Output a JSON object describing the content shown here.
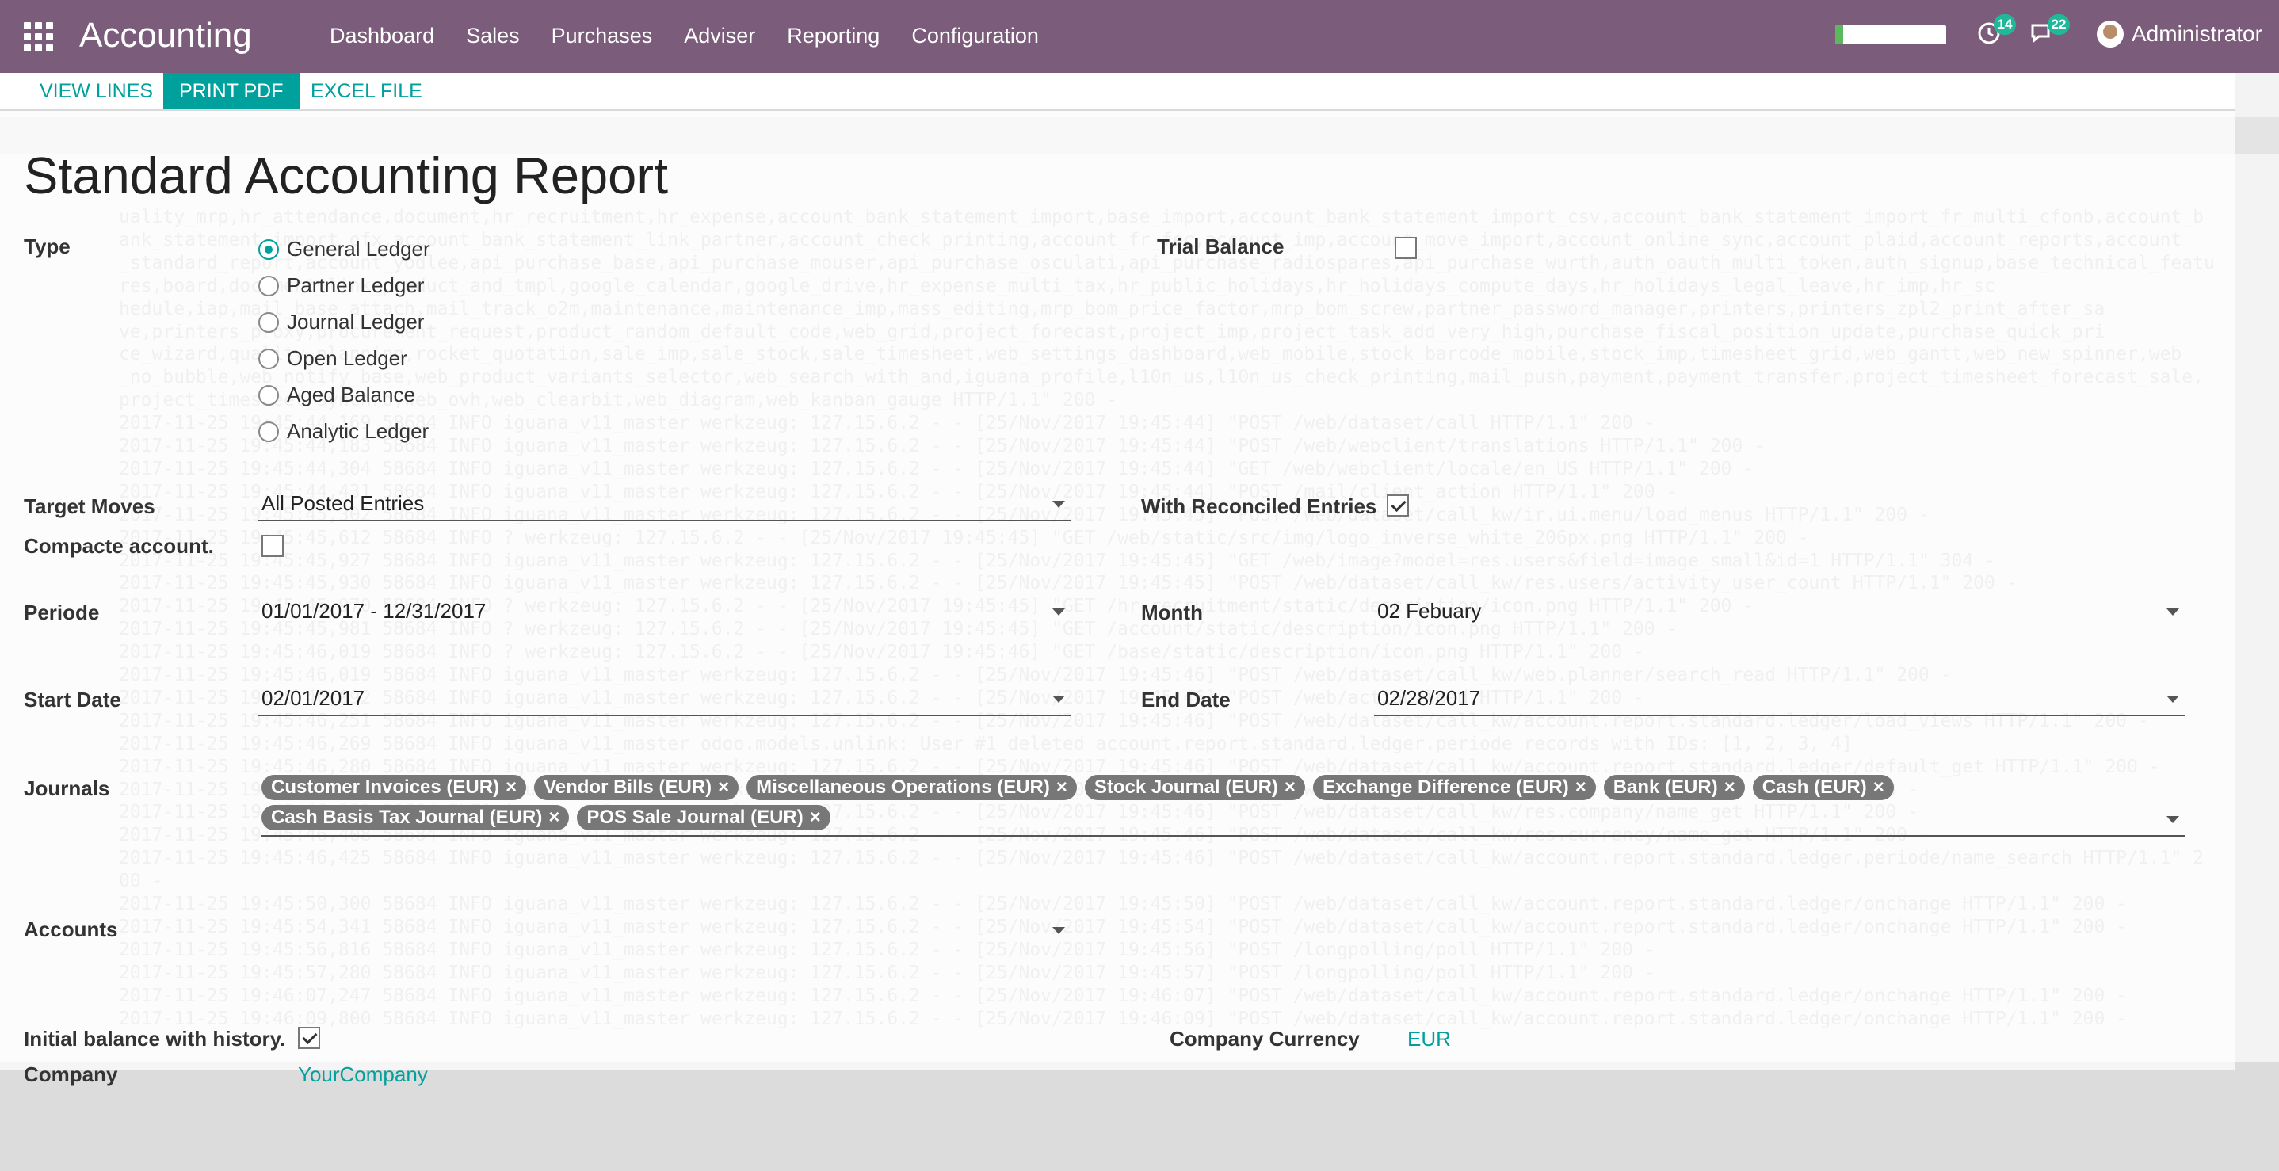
{
  "navbar": {
    "brand": "Accounting",
    "menu": [
      "Dashboard",
      "Sales",
      "Purchases",
      "Adviser",
      "Reporting",
      "Configuration"
    ],
    "activity_count": "14",
    "messages_count": "22",
    "user_name": "Administrator",
    "accent_color": "#7c5c7b"
  },
  "buttons": {
    "view_lines": "VIEW LINES",
    "print_pdf": "PRINT PDF",
    "excel_file": "EXCEL FILE"
  },
  "form": {
    "title": "Standard Accounting Report",
    "type_label": "Type",
    "type_options": [
      "General Ledger",
      "Partner Ledger",
      "Journal Ledger",
      "Open Ledger",
      "Aged Balance",
      "Analytic Ledger"
    ],
    "type_selected": "General Ledger",
    "trial_balance_label": "Trial Balance",
    "trial_balance_checked": false,
    "target_moves_label": "Target Moves",
    "target_moves_value": "All Posted Entries",
    "with_reconciled_label": "With Reconciled Entries",
    "with_reconciled_checked": true,
    "compacte_label": "Compacte account.",
    "compacte_checked": false,
    "periode_label": "Periode",
    "periode_value": "01/01/2017 - 12/31/2017",
    "month_label": "Month",
    "month_value": "02 Febuary",
    "start_date_label": "Start Date",
    "start_date_value": "02/01/2017",
    "end_date_label": "End Date",
    "end_date_value": "02/28/2017",
    "journals_label": "Journals",
    "journals": [
      "Customer Invoices (EUR)",
      "Vendor Bills (EUR)",
      "Miscellaneous Operations (EUR)",
      "Stock Journal (EUR)",
      "Exchange Difference (EUR)",
      "Bank (EUR)",
      "Cash (EUR)",
      "Cash Basis Tax Journal (EUR)",
      "POS Sale Journal (EUR)"
    ],
    "accounts_label": "Accounts",
    "accounts_value": "",
    "initial_balance_label": "Initial balance with history.",
    "initial_balance_checked": true,
    "company_currency_label": "Company Currency",
    "company_currency_value": "EUR",
    "company_label": "Company",
    "company_value": "YourCompany"
  },
  "background": {
    "terminal_lines": [
      "uality_mrp,hr_attendance,document,hr_recruitment,hr_expense,account_bank_statement_import,base_import,account_bank_statement_import_csv,account_bank_statement_import_fr_multi_cfonb,account_b",
      "ank_statement_import_ofx,account_bank_statement_link_partner,account_check_printing,account_fr_fec,account_imp,account_move_import,account_online_sync,account_plaid,account_reports,account",
      "_standard_report,account_yodlee,api_purchase_base,api_purchase_mouser,api_purchase_osculati,api_purchase_radiospares,api_purchase_wurth,auth_oauth_multi_token,auth_signup,base_technical_featu",
      "res,board,document_link_product_and_tmpl,google_calendar,google_drive,hr_expense_multi_tax,hr_public_holidays,hr_holidays_compute_days,hr_holidays_legal_leave,hr_imp,hr_sc",
      "hedule,iap,mail_base_attach,mail_track_o2m,maintenance,maintenance_imp,mass_editing,mrp_bom_price_factor,mrp_bom_screw,partner_password_manager,printers,printers_zpl2_print_after_sa",
      "ve,printers_proxy,procurement_request,product_random_default_code,web_grid,project_forecast,project_imp,project_task_add_very_high,purchase_fiscal_position_update,purchase_quick_pri",
      "ce_wizard,quality_planning,rocket_quotation,sale_imp,sale_stock,sale_timesheet,web_settings_dashboard,web_mobile,stock_barcode_mobile,stock_imp,timesheet_grid,web_gantt,web_new_spinner,web",
      "_no_bubble,web_notify_base,web_product_variants_selector,web_search_with_and,iguana_profile,l10n_us,l10n_us_check_printing,mail_push,payment,payment_transfer,project_timesheet_forecast_sale,",
      "project_timesheet_synchro,web_ovh,web_clearbit,web_diagram,web_kanban_gauge HTTP/1.1\" 200 -",
      "2017-11-25 19:45:44,169 58684 INFO iguana_v11_master werkzeug: 127.15.6.2 - - [25/Nov/2017 19:45:44] \"POST /web/dataset/call HTTP/1.1\" 200 -",
      "2017-11-25 19:45:44,183 58684 INFO iguana_v11_master werkzeug: 127.15.6.2 - - [25/Nov/2017 19:45:44] \"POST /web/webclient/translations HTTP/1.1\" 200 -",
      "2017-11-25 19:45:44,304 58684 INFO iguana_v11_master werkzeug: 127.15.6.2 - - [25/Nov/2017 19:45:44] \"GET /web/webclient/locale/en_US HTTP/1.1\" 200 -",
      "2017-11-25 19:45:44,431 58684 INFO iguana_v11_master werkzeug: 127.15.6.2 - - [25/Nov/2017 19:45:44] \"POST /mail/client_action HTTP/1.1\" 200 -",
      "2017-11-25 19:45:45,302 58684 INFO iguana_v11_master werkzeug: 127.15.6.2 - - [25/Nov/2017 19:45:45] \"POST /web/dataset/call_kw/ir.ui.menu/load_menus HTTP/1.1\" 200 -",
      "2017-11-25 19:45:45,612 58684 INFO ? werkzeug: 127.15.6.2 - - [25/Nov/2017 19:45:45] \"GET /web/static/src/img/logo_inverse_white_206px.png HTTP/1.1\" 200 -",
      "2017-11-25 19:45:45,927 58684 INFO iguana_v11_master werkzeug: 127.15.6.2 - - [25/Nov/2017 19:45:45] \"GET /web/image?model=res.users&field=image_small&id=1 HTTP/1.1\" 304 -",
      "2017-11-25 19:45:45,930 58684 INFO iguana_v11_master werkzeug: 127.15.6.2 - - [25/Nov/2017 19:45:45] \"POST /web/dataset/call_kw/res.users/activity_user_count HTTP/1.1\" 200 -",
      "2017-11-25 19:45:45,970 58684 INFO ? werkzeug: 127.15.6.2 - - [25/Nov/2017 19:45:45] \"GET /hr_recruitment/static/description/icon.png HTTP/1.1\" 200 -",
      "2017-11-25 19:45:45,981 58684 INFO ? werkzeug: 127.15.6.2 - - [25/Nov/2017 19:45:45] \"GET /account/static/description/icon.png HTTP/1.1\" 200 -",
      "2017-11-25 19:45:46,019 58684 INFO ? werkzeug: 127.15.6.2 - - [25/Nov/2017 19:45:46] \"GET /base/static/description/icon.png HTTP/1.1\" 200 -",
      "2017-11-25 19:45:46,019 58684 INFO iguana_v11_master werkzeug: 127.15.6.2 - - [25/Nov/2017 19:45:46] \"POST /web/dataset/call_kw/web.planner/search_read HTTP/1.1\" 200 -",
      "2017-11-25 19:45:46,092 58684 INFO iguana_v11_master werkzeug: 127.15.6.2 - - [25/Nov/2017 19:45:46] \"POST /web/action/load HTTP/1.1\" 200 -",
      "2017-11-25 19:45:46,251 58684 INFO iguana_v11_master werkzeug: 127.15.6.2 - - [25/Nov/2017 19:45:46] \"POST /web/dataset/call_kw/account.report.standard.ledger/load_views HTTP/1.1\" 200 -",
      "2017-11-25 19:45:46,269 58684 INFO iguana_v11_master odoo.models.unlink: User #1 deleted account.report.standard.ledger.periode records with IDs: [1, 2, 3, 4]",
      "2017-11-25 19:45:46,280 58684 INFO iguana_v11_master werkzeug: 127.15.6.2 - - [25/Nov/2017 19:45:46] \"POST /web/dataset/call_kw/account.report.standard.ledger/default_get HTTP/1.1\" 200 -",
      "2017-11-25 19:45:46,319 58684 INFO iguana_v11_master werkzeug: 127.15.6.2 - - [25/Nov/2017 19:45:46] \"POST /web/dataset/call_kw/account.journal/read HTTP/1.1\" 200 -",
      "2017-11-25 19:45:46,392 58684 INFO iguana_v11_master werkzeug: 127.15.6.2 - - [25/Nov/2017 19:45:46] \"POST /web/dataset/call_kw/res.company/name_get HTTP/1.1\" 200 -",
      "2017-11-25 19:45:46,408 58684 INFO iguana_v11_master werkzeug: 127.15.6.2 - - [25/Nov/2017 19:45:46] \"POST /web/dataset/call_kw/res.currency/name_get HTTP/1.1\" 200 -",
      "2017-11-25 19:45:46,425 58684 INFO iguana_v11_master werkzeug: 127.15.6.2 - - [25/Nov/2017 19:45:46] \"POST /web/dataset/call_kw/account.report.standard.ledger.periode/name_search HTTP/1.1\" 2",
      "00 -",
      "2017-11-25 19:45:50,300 58684 INFO iguana_v11_master werkzeug: 127.15.6.2 - - [25/Nov/2017 19:45:50] \"POST /web/dataset/call_kw/account.report.standard.ledger/onchange HTTP/1.1\" 200 -",
      "2017-11-25 19:45:54,341 58684 INFO iguana_v11_master werkzeug: 127.15.6.2 - - [25/Nov/2017 19:45:54] \"POST /web/dataset/call_kw/account.report.standard.ledger/onchange HTTP/1.1\" 200 -",
      "2017-11-25 19:45:56,816 58684 INFO iguana_v11_master werkzeug: 127.15.6.2 - - [25/Nov/2017 19:45:56] \"POST /longpolling/poll HTTP/1.1\" 200 -",
      "2017-11-25 19:45:57,280 58684 INFO iguana_v11_master werkzeug: 127.15.6.2 - - [25/Nov/2017 19:45:57] \"POST /longpolling/poll HTTP/1.1\" 200 -",
      "2017-11-25 19:46:07,247 58684 INFO iguana_v11_master werkzeug: 127.15.6.2 - - [25/Nov/2017 19:46:07] \"POST /web/dataset/call_kw/account.report.standard.ledger/onchange HTTP/1.1\" 200 -",
      "2017-11-25 19:46:09,800 58684 INFO iguana_v11_master werkzeug: 127.15.6.2 - - [25/Nov/2017 19:46:09] \"POST /web/dataset/call_kw/account.report.standard.ledger/onchange HTTP/1.1\" 200 -"
    ]
  }
}
